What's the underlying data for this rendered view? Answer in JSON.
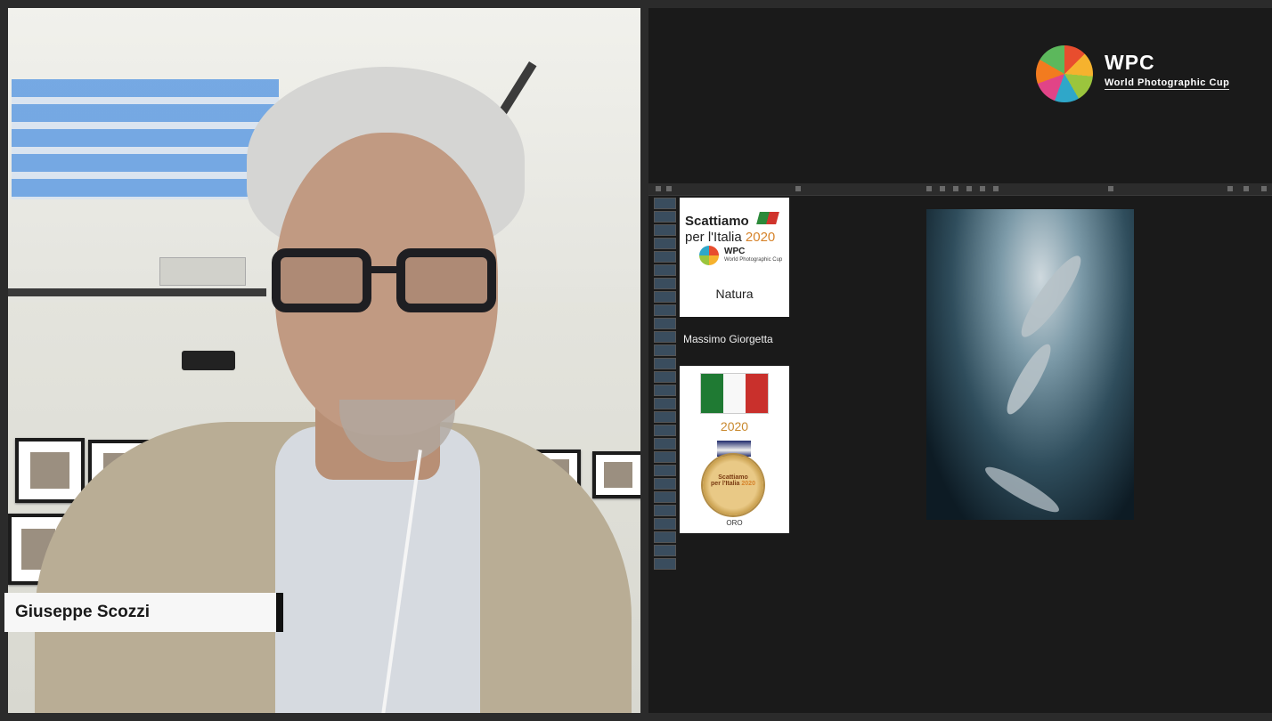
{
  "participant": {
    "name": "Giuseppe Scozzi"
  },
  "shared_screen": {
    "logo": {
      "icon": "wpc-globe-icon",
      "title": "WPC",
      "subtitle": "World Photographic Cup"
    },
    "title_card": {
      "line1": "Scattiamo",
      "line2": "per l'Italia",
      "year": "2020",
      "logo_text": "WPC",
      "logo_subtitle": "World Photographic Cup",
      "category": "Natura"
    },
    "author": "Massimo Giorgetta",
    "award_card": {
      "flag_icon": "italy-flag-icon",
      "year": "2020",
      "medal": {
        "icon": "gold-medal-icon",
        "line1": "Scattiamo",
        "line2": "per l'Italia",
        "year": "2020"
      },
      "award": "ORO"
    },
    "photo": {
      "subject": "sharks-underwater-photo"
    }
  },
  "colors": {
    "accent_orange": "#d6832a",
    "screen_bg": "#1a1a1a"
  }
}
